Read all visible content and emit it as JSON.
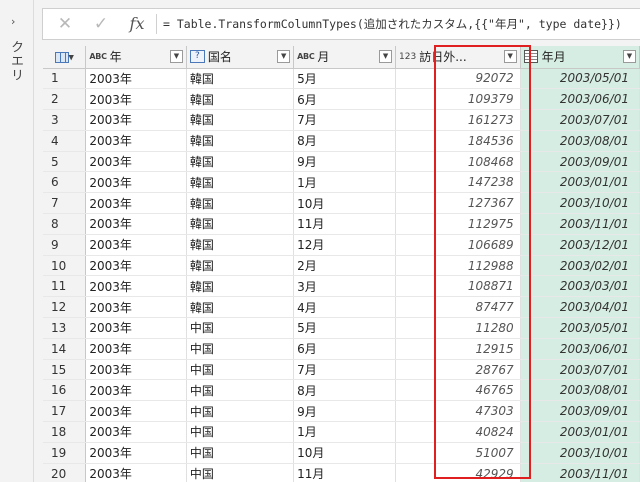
{
  "queries_pane": {
    "label": "クエリ",
    "chevron": "›"
  },
  "formula_bar": {
    "cancel_icon": "✕",
    "confirm_icon": "✓",
    "fx_label": "fx",
    "formula": "= Table.TransformColumnTypes(追加されたカスタム,{{\"年月\", type date}})"
  },
  "columns": [
    {
      "name": "年",
      "type": "text",
      "type_label": "ABC"
    },
    {
      "name": "国名",
      "type": "any",
      "type_label": "?"
    },
    {
      "name": "月",
      "type": "text",
      "type_label": "ABC"
    },
    {
      "name": "訪日外...",
      "type": "number",
      "type_label": "123"
    },
    {
      "name": "年月",
      "type": "date",
      "type_label": ""
    }
  ],
  "dropdown_glyph": "▼",
  "rows": [
    [
      "1",
      "2003年",
      "韓国",
      "5月",
      "92072",
      "2003/05/01"
    ],
    [
      "2",
      "2003年",
      "韓国",
      "6月",
      "109379",
      "2003/06/01"
    ],
    [
      "3",
      "2003年",
      "韓国",
      "7月",
      "161273",
      "2003/07/01"
    ],
    [
      "4",
      "2003年",
      "韓国",
      "8月",
      "184536",
      "2003/08/01"
    ],
    [
      "5",
      "2003年",
      "韓国",
      "9月",
      "108468",
      "2003/09/01"
    ],
    [
      "6",
      "2003年",
      "韓国",
      "1月",
      "147238",
      "2003/01/01"
    ],
    [
      "7",
      "2003年",
      "韓国",
      "10月",
      "127367",
      "2003/10/01"
    ],
    [
      "8",
      "2003年",
      "韓国",
      "11月",
      "112975",
      "2003/11/01"
    ],
    [
      "9",
      "2003年",
      "韓国",
      "12月",
      "106689",
      "2003/12/01"
    ],
    [
      "10",
      "2003年",
      "韓国",
      "2月",
      "112988",
      "2003/02/01"
    ],
    [
      "11",
      "2003年",
      "韓国",
      "3月",
      "108871",
      "2003/03/01"
    ],
    [
      "12",
      "2003年",
      "韓国",
      "4月",
      "87477",
      "2003/04/01"
    ],
    [
      "13",
      "2003年",
      "中国",
      "5月",
      "11280",
      "2003/05/01"
    ],
    [
      "14",
      "2003年",
      "中国",
      "6月",
      "12915",
      "2003/06/01"
    ],
    [
      "15",
      "2003年",
      "中国",
      "7月",
      "28767",
      "2003/07/01"
    ],
    [
      "16",
      "2003年",
      "中国",
      "8月",
      "46765",
      "2003/08/01"
    ],
    [
      "17",
      "2003年",
      "中国",
      "9月",
      "47303",
      "2003/09/01"
    ],
    [
      "18",
      "2003年",
      "中国",
      "1月",
      "40824",
      "2003/01/01"
    ],
    [
      "19",
      "2003年",
      "中国",
      "10月",
      "51007",
      "2003/10/01"
    ],
    [
      "20",
      "2003年",
      "中国",
      "11月",
      "42929",
      "2003/11/01"
    ]
  ],
  "colors": {
    "highlight_border": "#e02020",
    "date_column_fill": "#d6ede3"
  }
}
